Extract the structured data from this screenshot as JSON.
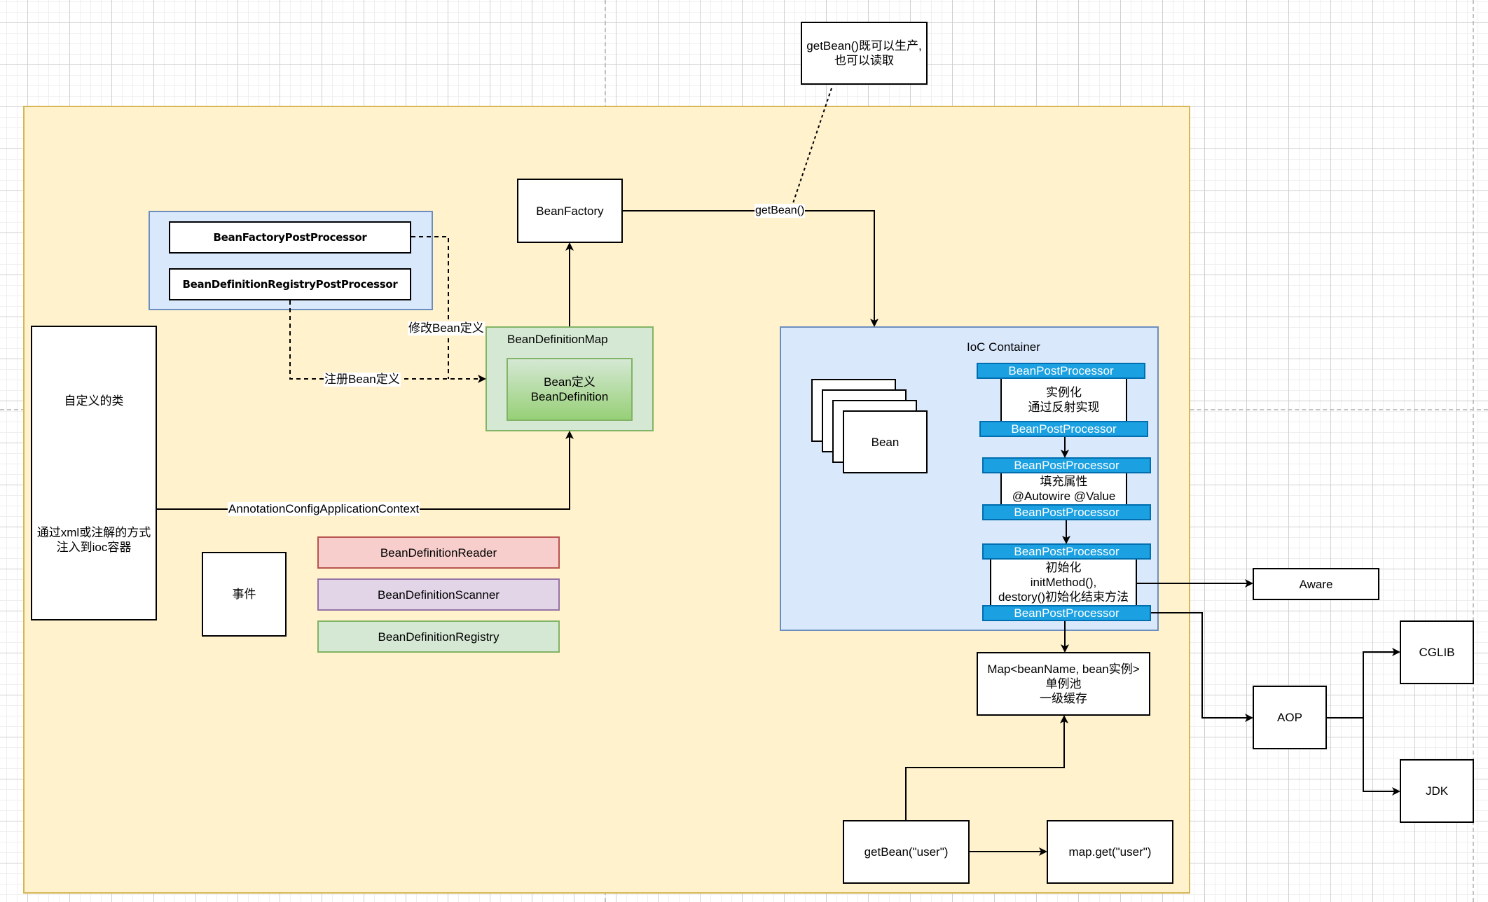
{
  "diagram": {
    "note": {
      "text": "getBean()既可以生产,\n也可以读取"
    },
    "bean_factory": {
      "label": "BeanFactory"
    },
    "post_processors": {
      "bean_factory_post_processor": "BeanFactoryPostProcessor",
      "bean_definition_registry_post_processor": "BeanDefinitionRegistryPostProcessor"
    },
    "custom_class": {
      "title": "自定义的类",
      "description": "通过xml或注解的方式\n注入到ioc容器"
    },
    "bean_definition_map": {
      "title": "BeanDefinitionMap",
      "inner": "Bean定义\nBeanDefinition"
    },
    "event_box": {
      "label": "事件"
    },
    "helpers": [
      {
        "label": "BeanDefinitionReader",
        "color": "#f8cecc"
      },
      {
        "label": "BeanDefinitionScanner",
        "color": "#e1d5e7"
      },
      {
        "label": "BeanDefinitionRegistry",
        "color": "#d5e8d4"
      }
    ],
    "ioc_container": {
      "title": "IoC Container",
      "bean_label": "Bean",
      "bpp_label": "BeanPostProcessor",
      "stages": [
        {
          "text": "实例化\n通过反射实现"
        },
        {
          "text": "填充属性\n@Autowire @Value"
        },
        {
          "text": "初始化\ninitMethod(),\ndestory()初始化结束方法"
        }
      ]
    },
    "singleton_map": {
      "text": "Map<beanName, bean实例>\n单例池\n一级缓存"
    },
    "get_bean_user": {
      "label": "getBean(\"user\")"
    },
    "map_get_user": {
      "label": "map.get(\"user\")"
    },
    "aware": {
      "label": "Aware"
    },
    "aop": {
      "label": "AOP"
    },
    "cglib": {
      "label": "CGLIB"
    },
    "jdk": {
      "label": "JDK"
    },
    "edge_labels": {
      "get_bean": "getBean()",
      "modify_bean_def": "修改Bean定义",
      "register_bean_def": "注册Bean定义",
      "annotation_context": "AnnotationConfigApplicationContext"
    },
    "colors": {
      "container_fill": "#fff2cc",
      "container_stroke": "#d6b656",
      "blue_fill": "#dae8fc",
      "blue_stroke": "#6c8ebf",
      "bpp_fill": "#1ba1e2",
      "green_fill": "#d5e8d4"
    }
  }
}
